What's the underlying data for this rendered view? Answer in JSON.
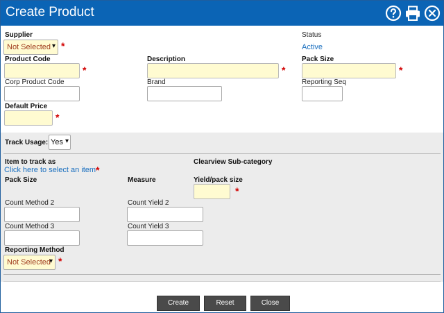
{
  "title": "Create Product",
  "icons": {
    "help": "question-circle-icon",
    "print": "printer-icon",
    "close": "close-circle-icon"
  },
  "colors": {
    "titlebar": "#0b64b5",
    "required_bg": "#fffbd1",
    "required_star": "#d20000",
    "link": "#1a6fbf"
  },
  "form": {
    "supplier_label": "Supplier",
    "supplier_value": "Not Selected",
    "status_label": "Status",
    "status_value": "Active",
    "product_code_label": "Product Code",
    "description_label": "Description",
    "pack_size_label": "Pack Size",
    "corp_product_code_label": "Corp Product Code",
    "brand_label": "Brand",
    "reporting_seq_label": "Reporting Seq",
    "default_price_label": "Default Price",
    "required_marker": "*"
  },
  "tracking": {
    "track_usage_label": "Track Usage:",
    "track_usage_value": "Yes",
    "item_to_track_label": "Item to track as",
    "select_item_link": "Click here to select an item",
    "clearview_label": "Clearview Sub-category",
    "pack_size_label": "Pack Size",
    "measure_label": "Measure",
    "yield_label": "Yield/pack size",
    "count_method_2_label": "Count Method 2",
    "count_yield_2_label": "Count Yield 2",
    "count_method_3_label": "Count Method 3",
    "count_yield_3_label": "Count Yield 3",
    "reporting_method_label": "Reporting Method",
    "reporting_method_value": "Not Selected"
  },
  "buttons": {
    "create": "Create",
    "reset": "Reset",
    "close": "Close"
  }
}
